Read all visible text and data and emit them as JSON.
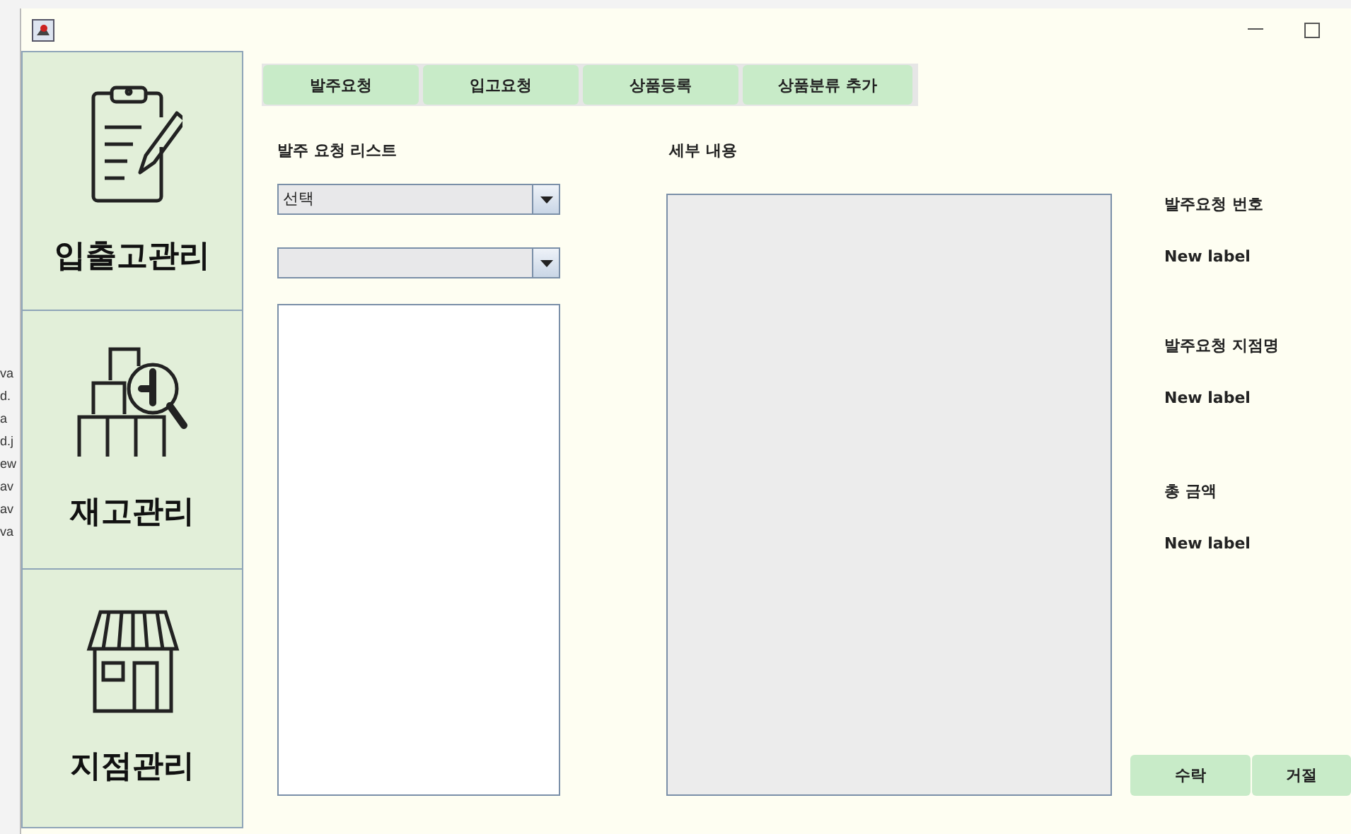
{
  "background_fragments": [
    "va",
    "d.",
    "a",
    "d.j",
    "ew",
    "av",
    "av",
    "va"
  ],
  "sidebar": {
    "items": [
      {
        "kind": "clipboard",
        "label": "입출고관리"
      },
      {
        "kind": "inventory",
        "label": "재고관리"
      },
      {
        "kind": "store",
        "label": "지점관리"
      }
    ]
  },
  "tabs": [
    {
      "label": "발주요청"
    },
    {
      "label": "입고요청"
    },
    {
      "label": "상품등록"
    },
    {
      "label": "상품분류 추가"
    }
  ],
  "order_list": {
    "title": "발주 요청 리스트",
    "combo_1": {
      "value": "선택"
    }
  },
  "details": {
    "title": "세부 내용"
  },
  "info": [
    {
      "label": "발주요청 번호",
      "value": "New label"
    },
    {
      "label": "발주요청 지점명",
      "value": "New label"
    },
    {
      "label": "총 금액",
      "value": "New label"
    }
  ],
  "buttons": [
    "수락",
    "거절"
  ]
}
